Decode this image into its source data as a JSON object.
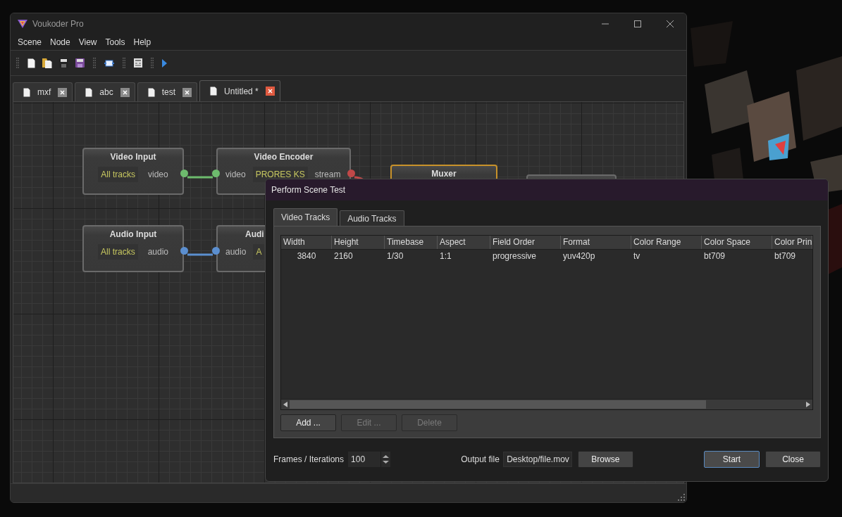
{
  "window": {
    "title": "Voukoder Pro"
  },
  "menu": [
    "Scene",
    "Node",
    "View",
    "Tools",
    "Help"
  ],
  "tabs": [
    {
      "label": "mxf",
      "selected": false
    },
    {
      "label": "abc",
      "selected": false
    },
    {
      "label": "test",
      "selected": false
    },
    {
      "label": "Untitled *",
      "selected": true
    }
  ],
  "canvas": {
    "nodes": [
      {
        "title": "Video Input",
        "field": "All tracks",
        "out": {
          "label": "video",
          "color": "#6dbb6d"
        },
        "selected": false
      },
      {
        "title": "Video Encoder",
        "in": {
          "label": "video",
          "color": "#6dbb6d"
        },
        "field": "PRORES KS",
        "out": {
          "label": "stream",
          "color": "#c04848"
        },
        "selected": false
      },
      {
        "title": "Audio Input",
        "field": "All tracks",
        "out": {
          "label": "audio",
          "color": "#5b8fd0"
        },
        "selected": false
      },
      {
        "title": "Audi",
        "in": {
          "label": "audio",
          "color": "#5b8fd0"
        },
        "field": "A",
        "selected": false
      },
      {
        "title": "Muxer",
        "selected": true
      },
      {
        "selected": false
      }
    ]
  },
  "dialog": {
    "title": "Perform Scene Test",
    "tabs": [
      {
        "label": "Video Tracks",
        "selected": true
      },
      {
        "label": "Audio Tracks",
        "selected": false
      }
    ],
    "table": {
      "columns": [
        "Width",
        "Height",
        "Timebase",
        "Aspect",
        "Field Order",
        "Format",
        "Color Range",
        "Color Space",
        "Color Prin"
      ],
      "rows": [
        [
          "3840",
          "2160",
          "1/30",
          "1:1",
          "progressive",
          "yuv420p",
          "tv",
          "bt709",
          "bt709"
        ]
      ]
    },
    "buttons": [
      {
        "label": "Add ...",
        "disabled": false
      },
      {
        "label": "Edit ...",
        "disabled": true
      },
      {
        "label": "Delete",
        "disabled": true
      }
    ],
    "frames": {
      "label": "Frames / Iterations",
      "value": "100"
    },
    "output": {
      "label": "Output file",
      "value": "Desktop/file.mov"
    },
    "browse": "Browse",
    "actions": [
      {
        "label": "Start",
        "default": true
      },
      {
        "label": "Close",
        "default": false
      }
    ]
  }
}
